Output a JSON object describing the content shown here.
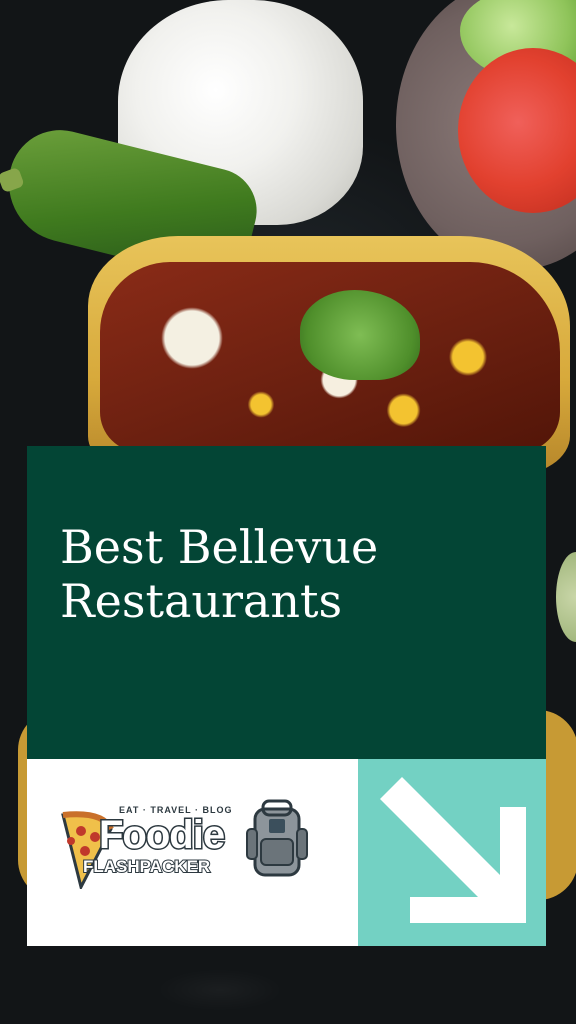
{
  "pin": {
    "title": "Best Bellevue Restaurants",
    "background_photo": "taco-with-rice-pepper-tomato",
    "colors": {
      "panel": "#034535",
      "logo_box": "#ffffff",
      "arrow_box": "#73d1c3",
      "arrow": "#ffffff",
      "title_text": "#ffffff"
    }
  },
  "logo": {
    "tagline": "EAT · TRAVEL · BLOG",
    "line1": "Foodie",
    "line2": "FLASHPACKER",
    "icons": [
      "pizza-slice-icon",
      "backpack-icon"
    ]
  },
  "arrow": {
    "icon": "arrow-down-right-icon"
  }
}
